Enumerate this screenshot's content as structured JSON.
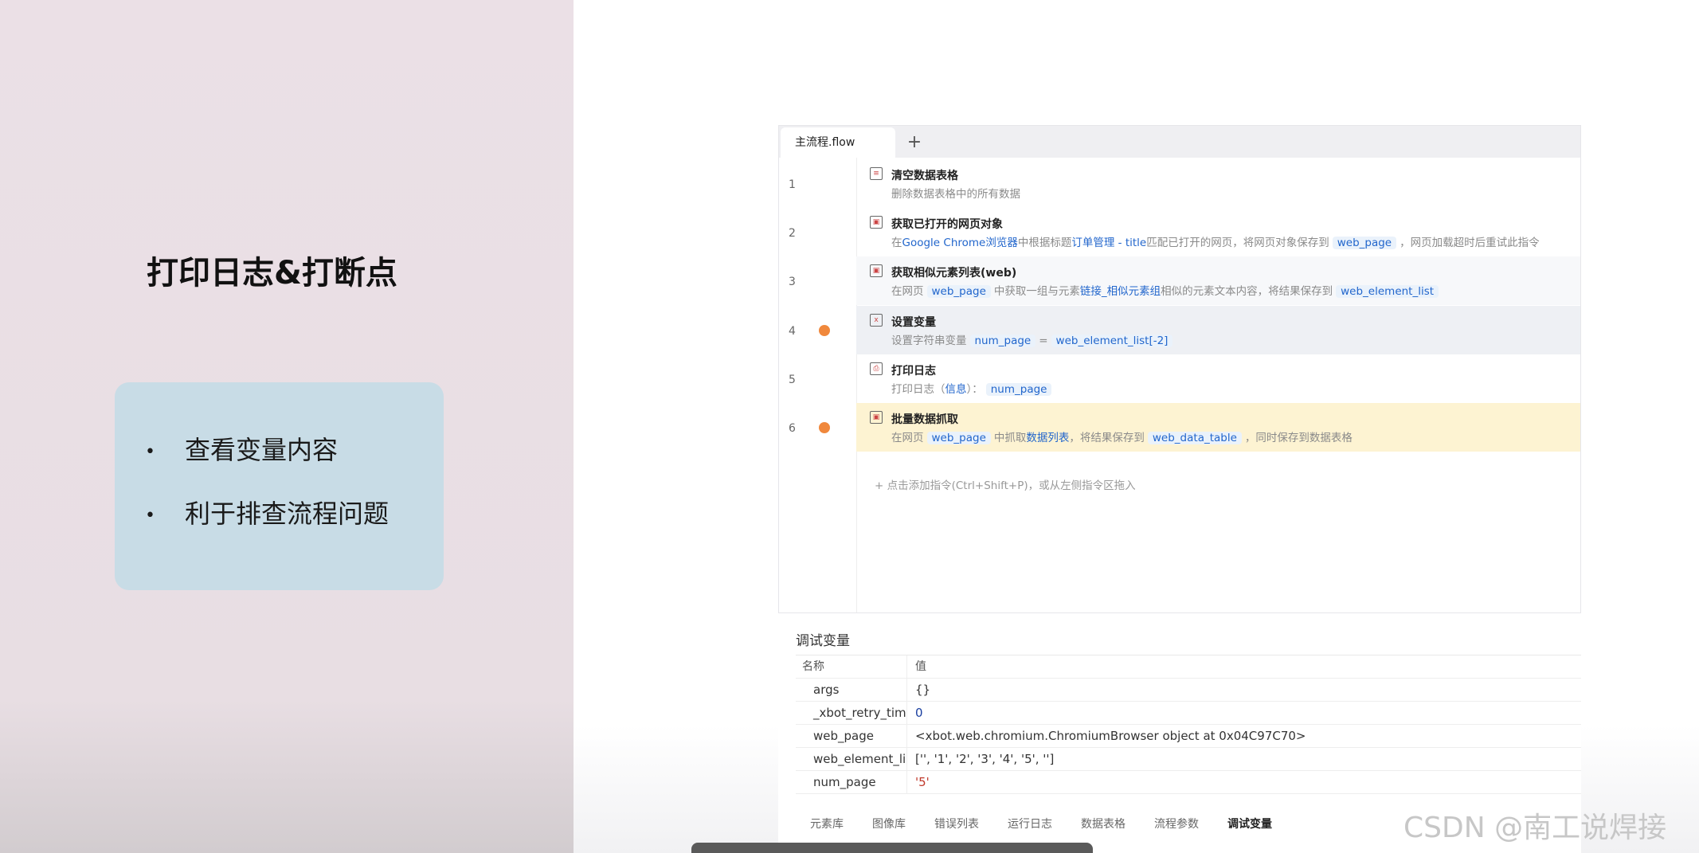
{
  "slide": {
    "title": "打印日志&打断点",
    "bullets": [
      "查看变量内容",
      "利于排查流程问题"
    ],
    "bullet_glyph": "•"
  },
  "editor": {
    "tab_label": "主流程.flow",
    "tab_add": "+",
    "rows": [
      {
        "num": "1",
        "title": "清空数据表格",
        "desc": [
          "删除数据表格中的所有数据"
        ],
        "breakpoint": false
      },
      {
        "num": "2",
        "title": "获取已打开的网页对象",
        "desc": [
          "在",
          "Google Chrome浏览器",
          "中根据标题",
          "订单管理 - title",
          "匹配已打开的网页，将网页对象保存到",
          "web_page",
          "，网页加载超时后重试此指令"
        ],
        "breakpoint": false
      },
      {
        "num": "3",
        "title": "获取相似元素列表(web)",
        "desc": [
          "在网页",
          "web_page",
          "中获取一组与元素",
          "链接_相似元素组",
          "相似的元素文本内容，将结果保存到",
          "web_element_list"
        ],
        "breakpoint": false
      },
      {
        "num": "4",
        "title": "设置变量",
        "desc": [
          "设置字符串变量",
          "num_page",
          "=",
          "web_element_list[-2]"
        ],
        "breakpoint": true
      },
      {
        "num": "5",
        "title": "打印日志",
        "desc": [
          "打印日志（",
          "信息",
          "）：",
          "num_page"
        ],
        "breakpoint": false
      },
      {
        "num": "6",
        "title": "批量数据抓取",
        "desc": [
          "在网页",
          "web_page",
          "中抓取",
          "数据列表",
          "，将结果保存到",
          "web_data_table",
          "，同时保存到数据表格"
        ],
        "breakpoint": true
      }
    ],
    "add_hint": "+ 点击添加指令(Ctrl+Shift+P)，或从左侧指令区拖入",
    "colors": {
      "highlight_row": "#fdf3d2",
      "selected_row": "#eef0f4",
      "link": "#2266cc",
      "breakpoint": "#f0883c"
    }
  },
  "debug": {
    "title": "调试变量",
    "header": {
      "name": "名称",
      "value": "值"
    },
    "vars": [
      {
        "name": "args",
        "value": "{}"
      },
      {
        "name": "_xbot_retry_time",
        "value": "0"
      },
      {
        "name": "web_page",
        "value": "<xbot.web.chromium.ChromiumBrowser object at 0x04C97C70>"
      },
      {
        "name": "web_element_list",
        "value": "['', '1', '2', '3', '4', '5', '']"
      },
      {
        "name": "num_page",
        "value": "'5'"
      }
    ],
    "tabs": [
      "元素库",
      "图像库",
      "错误列表",
      "运行日志",
      "数据表格",
      "流程参数",
      "调试变量"
    ],
    "active_tab": "调试变量"
  },
  "watermark": "CSDN @南工说焊接"
}
